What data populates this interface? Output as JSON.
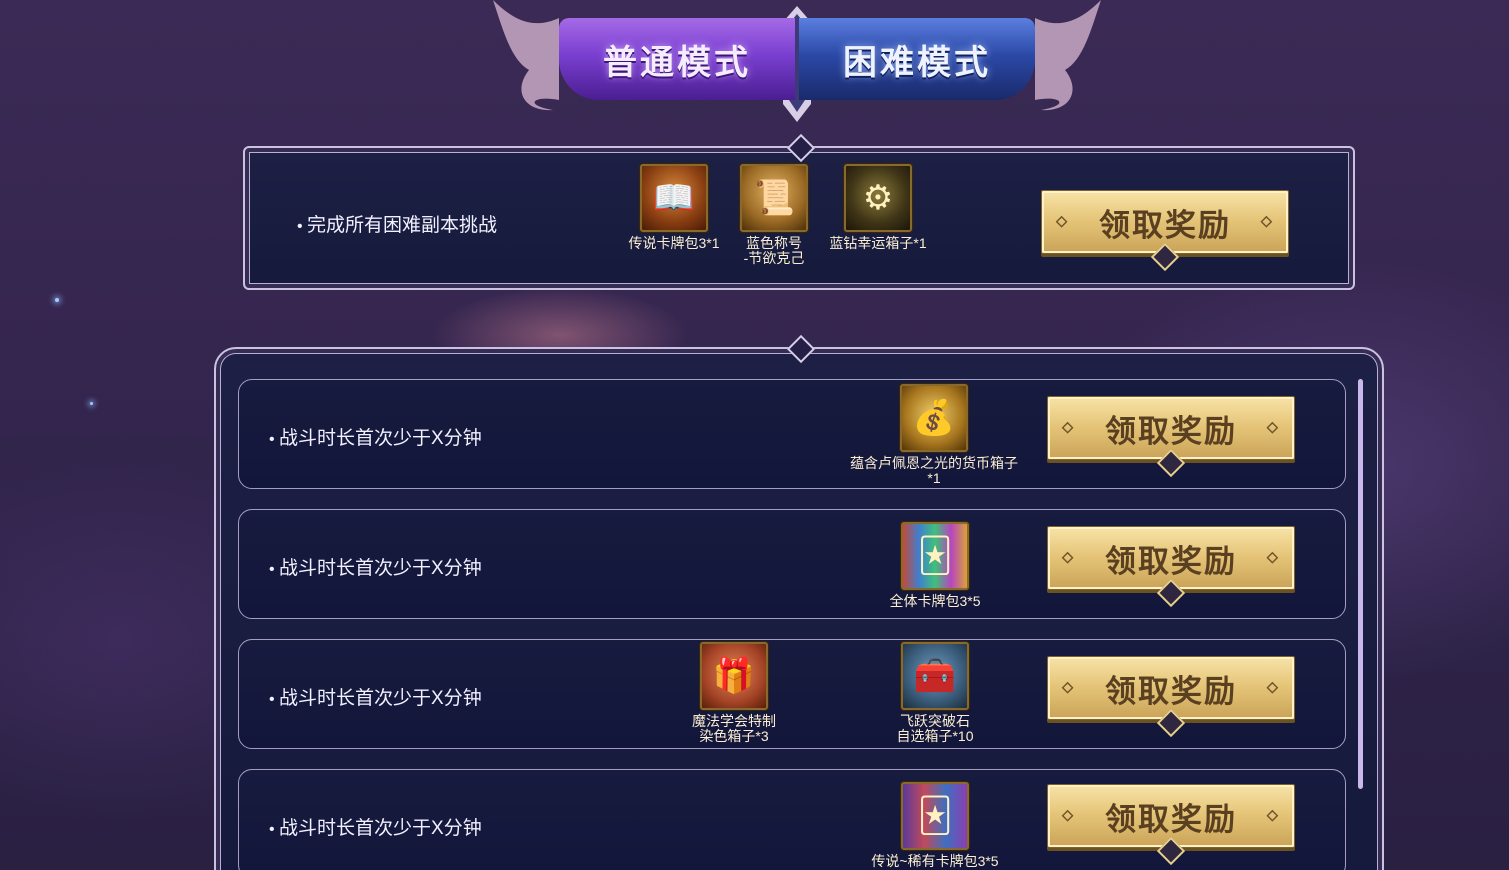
{
  "tabs": {
    "normal": "普通模式",
    "hard": "困难模式",
    "active": "hard"
  },
  "top_task": {
    "text": "完成所有困难副本挑战",
    "rewards": [
      {
        "icon": "legend-card-pack-icon",
        "label": "传说卡牌包3*1"
      },
      {
        "icon": "title-scroll-icon",
        "label_line1": "蓝色称号",
        "label_line2": "-节欲克己"
      },
      {
        "icon": "blue-diamond-chest-icon",
        "label": "蓝钻幸运箱子*1"
      }
    ],
    "button": "领取奖励"
  },
  "tasks": [
    {
      "text": "战斗时长首次少于X分钟",
      "rewards": [
        {
          "icon": "currency-chest-icon",
          "label_line1": "蕴含卢佩恩之光的货币箱子",
          "label_line2": "*1"
        }
      ],
      "button": "领取奖励"
    },
    {
      "text": "战斗时长首次少于X分钟",
      "rewards": [
        {
          "icon": "all-card-pack-icon",
          "label": "全体卡牌包3*5"
        }
      ],
      "button": "领取奖励"
    },
    {
      "text": "战斗时长首次少于X分钟",
      "rewards": [
        {
          "icon": "gift-box-icon",
          "label_line1": "魔法学会特制",
          "label_line2": "染色箱子*3"
        },
        {
          "icon": "breakthrough-stone-chest-icon",
          "label_line1": "飞跃突破石",
          "label_line2": "自选箱子*10"
        }
      ],
      "button": "领取奖励"
    },
    {
      "text": "战斗时长首次少于X分钟",
      "rewards": [
        {
          "icon": "rare-card-pack-icon",
          "label": "传说~稀有卡牌包3*5"
        }
      ],
      "button": "领取奖励"
    }
  ],
  "colors": {
    "background": "#35264f",
    "panel": "#171b3e",
    "button_gold": "#e6c67a",
    "text_light": "#f3f1ff"
  }
}
